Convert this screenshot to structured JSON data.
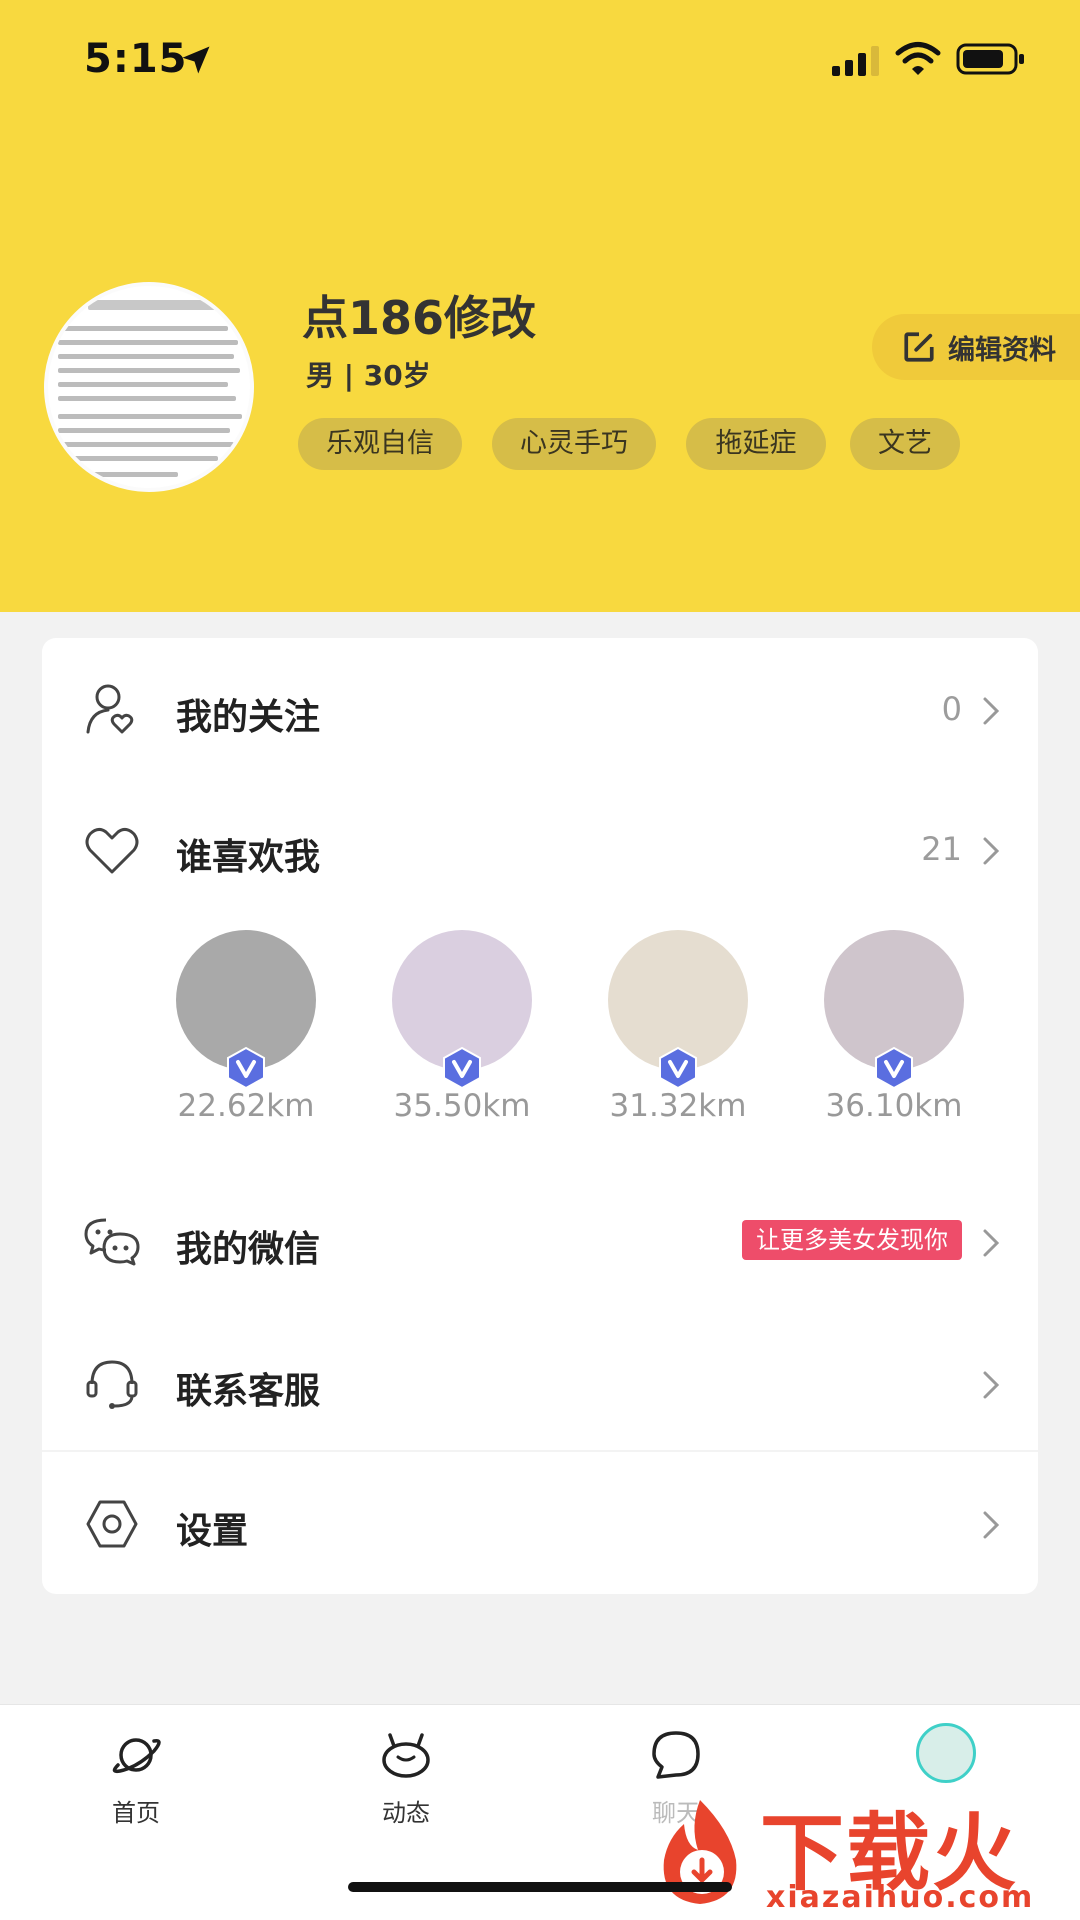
{
  "status_bar": {
    "time": "5:15"
  },
  "profile": {
    "nickname": "点186修改",
    "meta": "男 | 30岁",
    "tags": [
      "乐观自信",
      "心灵手巧",
      "拖延症",
      "文艺"
    ],
    "edit_label": "编辑资料"
  },
  "menu": {
    "following": {
      "label": "我的关注",
      "count": "0"
    },
    "likes": {
      "label": "谁喜欢我",
      "count": "21"
    },
    "likers": [
      {
        "distance": "22.62km"
      },
      {
        "distance": "35.50km"
      },
      {
        "distance": "31.32km"
      },
      {
        "distance": "36.10km"
      }
    ],
    "wechat": {
      "label": "我的微信",
      "badge": "让更多美女发现你"
    },
    "support": {
      "label": "联系客服"
    },
    "settings": {
      "label": "设置"
    }
  },
  "tabbar": {
    "items": [
      {
        "label": "首页",
        "icon": "planet-icon"
      },
      {
        "label": "动态",
        "icon": "critter-icon"
      },
      {
        "label": "聊天",
        "icon": "chat-bubble-icon"
      },
      {
        "label": "",
        "icon": "avatar"
      }
    ]
  },
  "watermark": {
    "text": "下载火",
    "url": "xiazaihuo.com"
  },
  "colors": {
    "header": "#f8d93f",
    "tag_bg": "#d6bd48",
    "promo": "#ee4d6a",
    "verified": "#5a6ee0",
    "watermark": "#e8442d"
  }
}
